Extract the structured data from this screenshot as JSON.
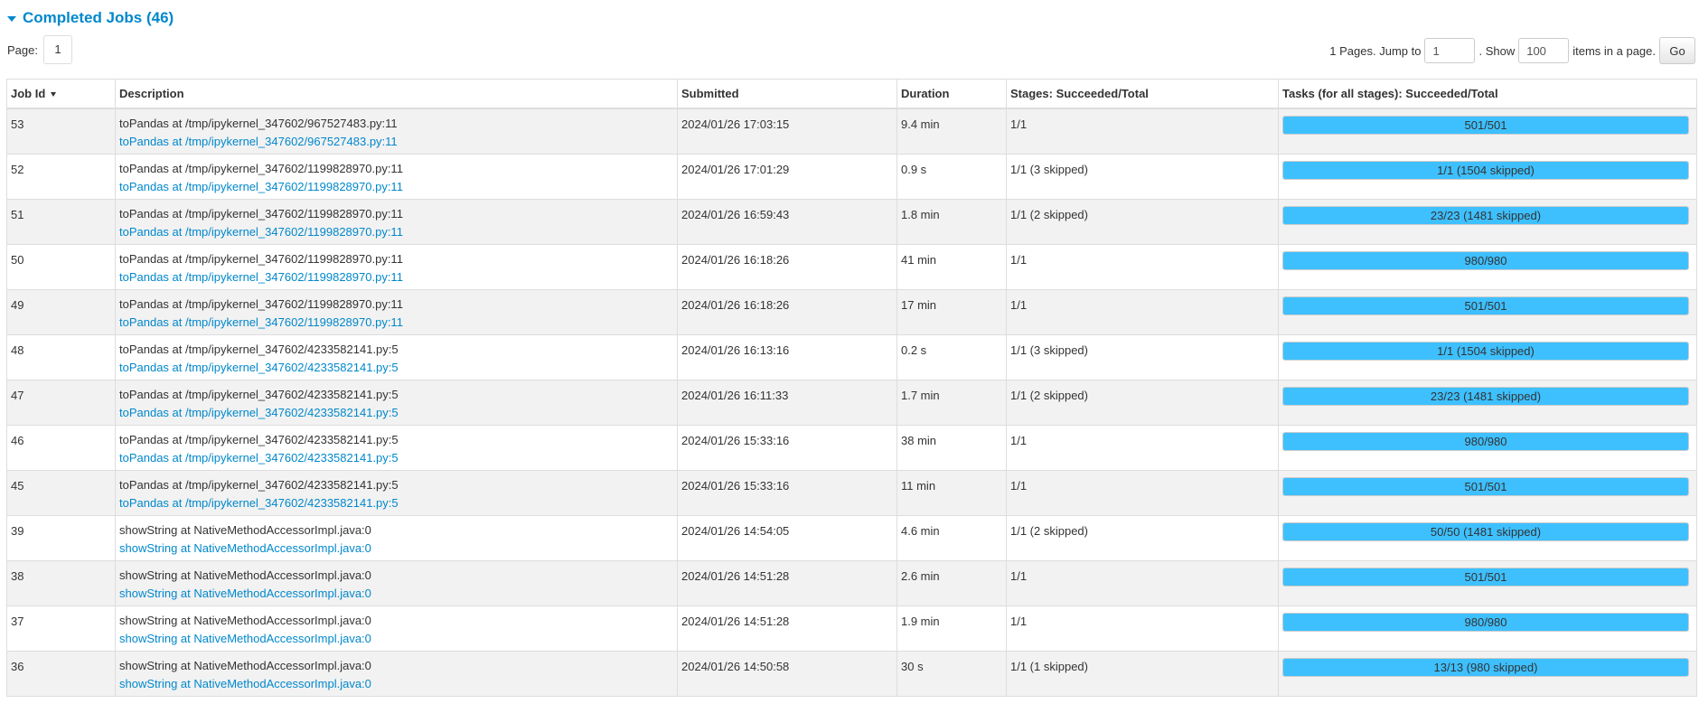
{
  "section": {
    "title": "Completed Jobs (46)"
  },
  "pager": {
    "page_label": "Page:",
    "current_page": "1",
    "pages_text": "1 Pages. Jump to",
    "jump_value": "1",
    "show_text": ". Show",
    "show_value": "100",
    "items_text": "items in a page.",
    "go_label": "Go"
  },
  "table": {
    "headers": {
      "job_id": "Job Id",
      "description": "Description",
      "submitted": "Submitted",
      "duration": "Duration",
      "stages": "Stages: Succeeded/Total",
      "tasks": "Tasks (for all stages): Succeeded/Total"
    },
    "sort_icon": "sort-desc-arrow",
    "rows": [
      {
        "id": "53",
        "desc": "toPandas at /tmp/ipykernel_347602/967527483.py:11",
        "link": "toPandas at /tmp/ipykernel_347602/967527483.py:11",
        "submitted": "2024/01/26 17:03:15",
        "duration": "9.4 min",
        "stages": "1/1",
        "tasks": "501/501",
        "progress": 1.0
      },
      {
        "id": "52",
        "desc": "toPandas at /tmp/ipykernel_347602/1199828970.py:11",
        "link": "toPandas at /tmp/ipykernel_347602/1199828970.py:11",
        "submitted": "2024/01/26 17:01:29",
        "duration": "0.9 s",
        "stages": "1/1 (3 skipped)",
        "tasks": "1/1 (1504 skipped)",
        "progress": 1.0
      },
      {
        "id": "51",
        "desc": "toPandas at /tmp/ipykernel_347602/1199828970.py:11",
        "link": "toPandas at /tmp/ipykernel_347602/1199828970.py:11",
        "submitted": "2024/01/26 16:59:43",
        "duration": "1.8 min",
        "stages": "1/1 (2 skipped)",
        "tasks": "23/23 (1481 skipped)",
        "progress": 1.0
      },
      {
        "id": "50",
        "desc": "toPandas at /tmp/ipykernel_347602/1199828970.py:11",
        "link": "toPandas at /tmp/ipykernel_347602/1199828970.py:11",
        "submitted": "2024/01/26 16:18:26",
        "duration": "41 min",
        "stages": "1/1",
        "tasks": "980/980",
        "progress": 1.0
      },
      {
        "id": "49",
        "desc": "toPandas at /tmp/ipykernel_347602/1199828970.py:11",
        "link": "toPandas at /tmp/ipykernel_347602/1199828970.py:11",
        "submitted": "2024/01/26 16:18:26",
        "duration": "17 min",
        "stages": "1/1",
        "tasks": "501/501",
        "progress": 1.0
      },
      {
        "id": "48",
        "desc": "toPandas at /tmp/ipykernel_347602/4233582141.py:5",
        "link": "toPandas at /tmp/ipykernel_347602/4233582141.py:5",
        "submitted": "2024/01/26 16:13:16",
        "duration": "0.2 s",
        "stages": "1/1 (3 skipped)",
        "tasks": "1/1 (1504 skipped)",
        "progress": 1.0
      },
      {
        "id": "47",
        "desc": "toPandas at /tmp/ipykernel_347602/4233582141.py:5",
        "link": "toPandas at /tmp/ipykernel_347602/4233582141.py:5",
        "submitted": "2024/01/26 16:11:33",
        "duration": "1.7 min",
        "stages": "1/1 (2 skipped)",
        "tasks": "23/23 (1481 skipped)",
        "progress": 1.0
      },
      {
        "id": "46",
        "desc": "toPandas at /tmp/ipykernel_347602/4233582141.py:5",
        "link": "toPandas at /tmp/ipykernel_347602/4233582141.py:5",
        "submitted": "2024/01/26 15:33:16",
        "duration": "38 min",
        "stages": "1/1",
        "tasks": "980/980",
        "progress": 1.0
      },
      {
        "id": "45",
        "desc": "toPandas at /tmp/ipykernel_347602/4233582141.py:5",
        "link": "toPandas at /tmp/ipykernel_347602/4233582141.py:5",
        "submitted": "2024/01/26 15:33:16",
        "duration": "11 min",
        "stages": "1/1",
        "tasks": "501/501",
        "progress": 1.0
      },
      {
        "id": "39",
        "desc": "showString at NativeMethodAccessorImpl.java:0",
        "link": "showString at NativeMethodAccessorImpl.java:0",
        "submitted": "2024/01/26 14:54:05",
        "duration": "4.6 min",
        "stages": "1/1 (2 skipped)",
        "tasks": "50/50 (1481 skipped)",
        "progress": 1.0
      },
      {
        "id": "38",
        "desc": "showString at NativeMethodAccessorImpl.java:0",
        "link": "showString at NativeMethodAccessorImpl.java:0",
        "submitted": "2024/01/26 14:51:28",
        "duration": "2.6 min",
        "stages": "1/1",
        "tasks": "501/501",
        "progress": 1.0
      },
      {
        "id": "37",
        "desc": "showString at NativeMethodAccessorImpl.java:0",
        "link": "showString at NativeMethodAccessorImpl.java:0",
        "submitted": "2024/01/26 14:51:28",
        "duration": "1.9 min",
        "stages": "1/1",
        "tasks": "980/980",
        "progress": 1.0
      },
      {
        "id": "36",
        "desc": "showString at NativeMethodAccessorImpl.java:0",
        "link": "showString at NativeMethodAccessorImpl.java:0",
        "submitted": "2024/01/26 14:50:58",
        "duration": "30 s",
        "stages": "1/1 (1 skipped)",
        "tasks": "13/13 (980 skipped)",
        "progress": 1.0
      }
    ]
  },
  "colors": {
    "link": "#0088cc",
    "progress_bar": "#3ec0ff",
    "row_stripe": "#f2f2f2"
  }
}
